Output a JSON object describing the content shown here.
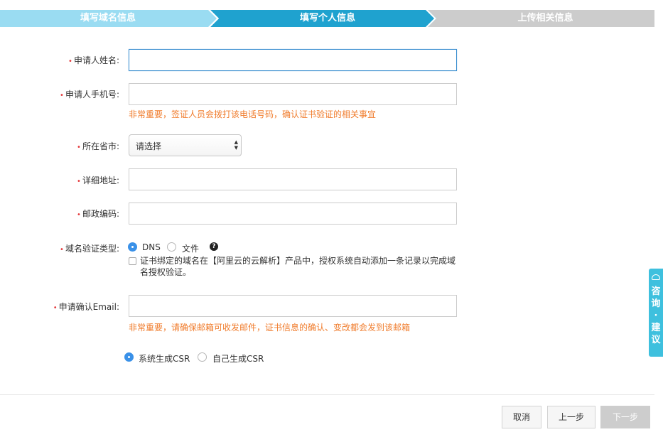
{
  "steps": [
    {
      "label": "填写域名信息",
      "state": "done"
    },
    {
      "label": "填写个人信息",
      "state": "active"
    },
    {
      "label": "上传相关信息",
      "state": "pending"
    }
  ],
  "form": {
    "name_label": "申请人姓名:",
    "phone_label": "申请人手机号:",
    "phone_hint": "非常重要，签证人员会拨打该电话号码，确认证书验证的相关事宜",
    "province_label": "所在省市:",
    "province_value": "请选择",
    "address_label": "详细地址:",
    "zip_label": "邮政编码:",
    "verify_label": "域名验证类型:",
    "verify_options": [
      {
        "label": "DNS",
        "selected": true
      },
      {
        "label": "文件",
        "selected": false
      }
    ],
    "help_glyph": "?",
    "aliyun_checkbox_text": "证书绑定的域名在【阿里云的云解析】产品中，授权系统自动添加一条记录以完成域名授权验证。",
    "aliyun_checkbox_checked": false,
    "email_label": "申请确认Email:",
    "email_hint": "非常重要，请确保邮箱可收发邮件，证书信息的确认、变改都会发到该邮箱",
    "csr_options": [
      {
        "label": "系统生成CSR",
        "selected": true
      },
      {
        "label": "自己生成CSR",
        "selected": false
      }
    ],
    "required_mark": "•"
  },
  "buttons": {
    "cancel": "取消",
    "prev": "上一步",
    "next": "下一步"
  },
  "float_tab": {
    "text": "咨询·建议"
  },
  "colors": {
    "step_done": "#9adcf2",
    "step_active": "#1fa2cf",
    "step_pending": "#cccccc",
    "hint": "#f07c2c",
    "required": "#e4393c",
    "radio_on": "#3a91e8",
    "float_tab": "#3ec0de"
  }
}
